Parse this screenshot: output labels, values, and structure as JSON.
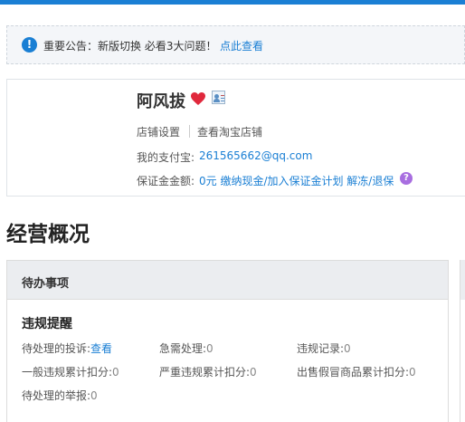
{
  "notice": {
    "text": "重要公告：新版切换 必看3大问题！",
    "link": "点此查看"
  },
  "shop": {
    "name": "阿风拔",
    "settings_label": "店铺设置",
    "view_label": "查看淘宝店铺",
    "alipay_label": "我的支付宝:",
    "alipay_value": "261565662@qq.com",
    "deposit_label": "保证金金额:",
    "deposit_value": "0元 缴纳现金/加入保证金计划 解冻/退保",
    "help_glyph": "?"
  },
  "section": {
    "title": "经营概况"
  },
  "todo": {
    "title": "待办事项",
    "violation_title": "违规提醒",
    "items": [
      {
        "label": "待处理的投诉:",
        "value": "查看"
      },
      {
        "label": "急需处理:",
        "value": "0"
      },
      {
        "label": "违规记录:",
        "value": "0"
      },
      {
        "label": "一般违规累计扣分:",
        "value": "0"
      },
      {
        "label": "严重违规累计扣分:",
        "value": "0"
      },
      {
        "label": "出售假冒商品累计扣分:",
        "value": "0"
      },
      {
        "label": "待处理的举报:",
        "value": "0"
      }
    ]
  },
  "colors": {
    "accent": "#1a7fd4",
    "heart": "#e0283c",
    "help": "#a86ee0"
  },
  "icons": {
    "notice": "info-icon",
    "heart": "heart-icon",
    "vcard": "vcard-icon",
    "help": "help-icon"
  }
}
